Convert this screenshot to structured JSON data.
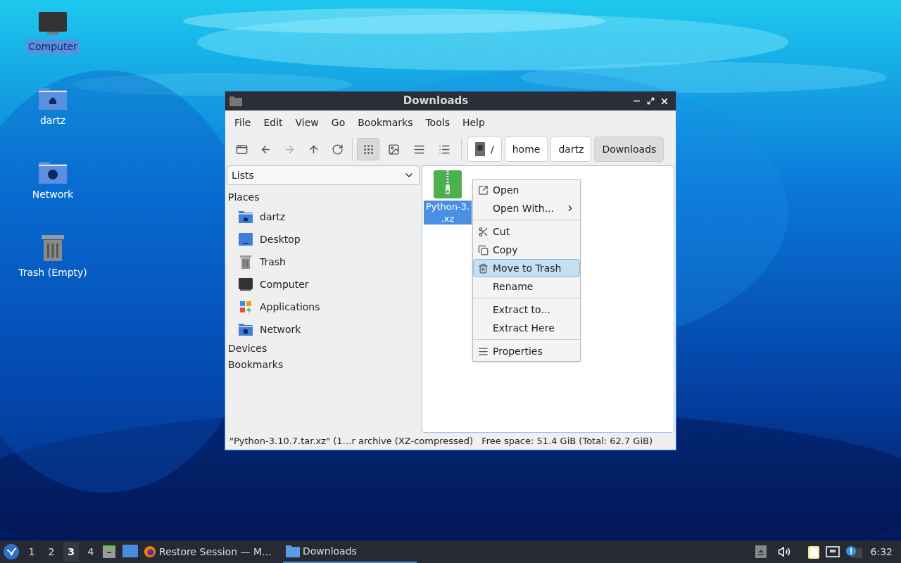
{
  "desktop_icons": [
    {
      "label": "Computer",
      "kind": "computer",
      "selected": true
    },
    {
      "label": "dartz",
      "kind": "home",
      "selected": false
    },
    {
      "label": "Network",
      "kind": "network",
      "selected": false
    },
    {
      "label": "Trash (Empty)",
      "kind": "trash",
      "selected": false
    }
  ],
  "window": {
    "title": "Downloads",
    "menu": [
      "File",
      "Edit",
      "View",
      "Go",
      "Bookmarks",
      "Tools",
      "Help"
    ],
    "nav_buttons": [
      {
        "kind": "new-tab",
        "disabled": false
      },
      {
        "kind": "back",
        "disabled": false
      },
      {
        "kind": "forward",
        "disabled": true
      },
      {
        "kind": "up",
        "disabled": false
      },
      {
        "kind": "reload",
        "disabled": false
      }
    ],
    "view_modes": [
      {
        "kind": "icons",
        "selected": true
      },
      {
        "kind": "thumbnails",
        "selected": false
      },
      {
        "kind": "compact",
        "selected": false
      },
      {
        "kind": "details",
        "selected": false
      }
    ],
    "path": [
      {
        "label": "/",
        "kind": "root",
        "selected": false
      },
      {
        "label": "home",
        "kind": "dir",
        "selected": false
      },
      {
        "label": "dartz",
        "kind": "dir",
        "selected": false
      },
      {
        "label": "Downloads",
        "kind": "dir",
        "selected": true
      }
    ],
    "side_dropdown": "Lists",
    "sections": [
      {
        "title": "Places",
        "items": [
          {
            "label": "dartz",
            "kind": "home"
          },
          {
            "label": "Desktop",
            "kind": "desktop"
          },
          {
            "label": "Trash",
            "kind": "trash"
          },
          {
            "label": "Computer",
            "kind": "computer"
          },
          {
            "label": "Applications",
            "kind": "apps"
          },
          {
            "label": "Network",
            "kind": "network"
          }
        ]
      },
      {
        "title": "Devices"
      },
      {
        "title": "Bookmarks"
      }
    ],
    "files": [
      {
        "lines": [
          "Python-3.",
          ".xz"
        ],
        "kind": "archive",
        "selected": true
      }
    ],
    "context_menu": [
      {
        "items": [
          {
            "label": "Open",
            "kind": "open",
            "submenu": false,
            "selected": false
          },
          {
            "label": "Open With...",
            "kind": "plain",
            "submenu": true,
            "selected": false
          }
        ]
      },
      {
        "items": [
          {
            "label": "Cut",
            "kind": "cut",
            "submenu": false,
            "selected": false
          },
          {
            "label": "Copy",
            "kind": "copy",
            "submenu": false,
            "selected": false
          },
          {
            "label": "Move to Trash",
            "kind": "trash",
            "submenu": false,
            "selected": true
          },
          {
            "label": "Rename",
            "kind": "plain",
            "submenu": false,
            "selected": false
          }
        ]
      },
      {
        "items": [
          {
            "label": "Extract to...",
            "kind": "plain",
            "submenu": false,
            "selected": false
          },
          {
            "label": "Extract Here",
            "kind": "plain",
            "submenu": false,
            "selected": false
          }
        ]
      },
      {
        "items": [
          {
            "label": "Properties",
            "kind": "properties",
            "submenu": false,
            "selected": false
          }
        ]
      }
    ],
    "status_left": "\"Python-3.10.7.tar.xz\" (1…r archive (XZ-compressed)",
    "status_right": "Free space: 51.4 GiB (Total: 62.7 GiB)"
  },
  "taskbar": {
    "workspaces": [
      {
        "label": "1",
        "selected": false
      },
      {
        "label": "2",
        "selected": false
      },
      {
        "label": "3",
        "selected": true
      },
      {
        "label": "4",
        "selected": false
      }
    ],
    "tasks": [
      {
        "label": "Restore Session — M…",
        "kind": "browser",
        "selected": false
      },
      {
        "label": "Downloads",
        "kind": "folder",
        "selected": true
      }
    ],
    "clock": "6:32"
  }
}
